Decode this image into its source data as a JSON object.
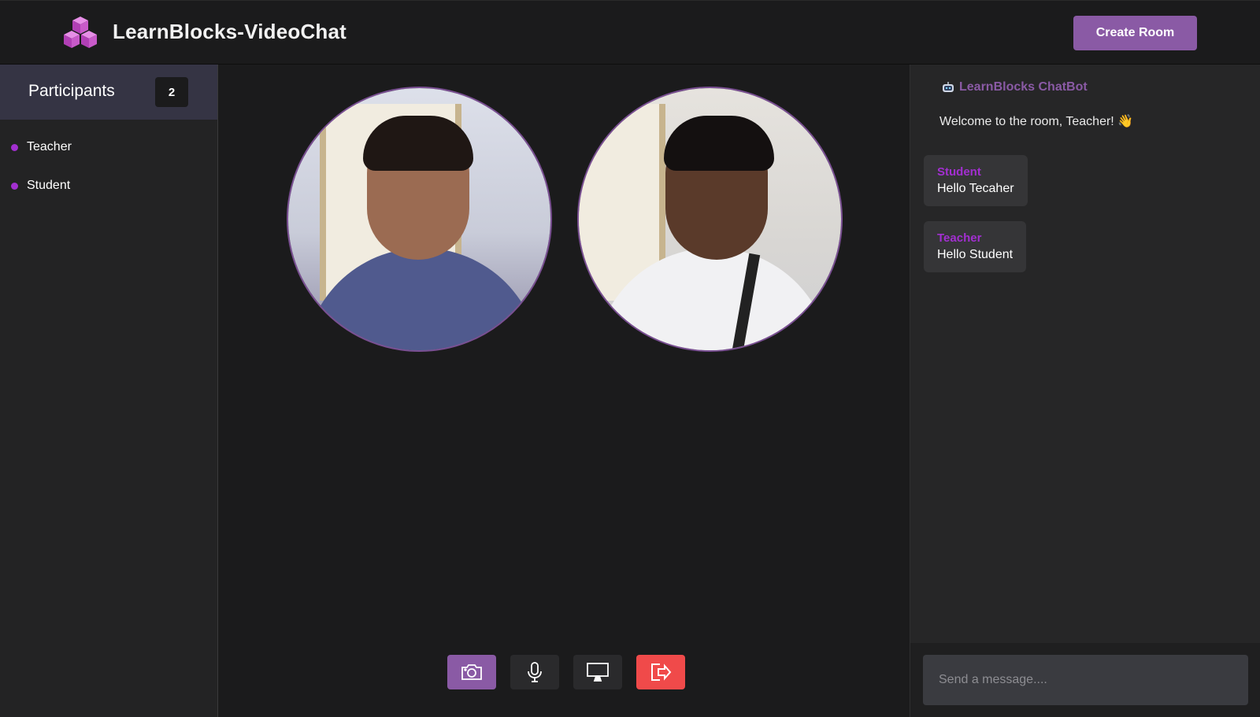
{
  "header": {
    "app_title": "LearnBlocks-VideoChat",
    "create_room_label": "Create Room",
    "logo_icon": "cubes-logo-icon"
  },
  "sidebar": {
    "title": "Participants",
    "count": "2",
    "participants": [
      {
        "name": "Teacher"
      },
      {
        "name": "Student"
      }
    ]
  },
  "controls": {
    "camera_icon": "camera-icon",
    "mic_icon": "microphone-icon",
    "screen_icon": "monitor-icon",
    "leave_icon": "exit-icon"
  },
  "chat": {
    "bot_name": "LearnBlocks ChatBot",
    "bot_icon": "robot-icon",
    "welcome": "Welcome to the room, Teacher! 👋",
    "messages": [
      {
        "sender": "Student",
        "text": "Hello Tecaher"
      },
      {
        "sender": "Teacher",
        "text": "Hello Student"
      }
    ],
    "input_placeholder": "Send a message...."
  },
  "colors": {
    "accent": "#8a5aa5",
    "participant_dot": "#a22fd0",
    "leave": "#f04a4a",
    "background": "#1b1b1c"
  }
}
